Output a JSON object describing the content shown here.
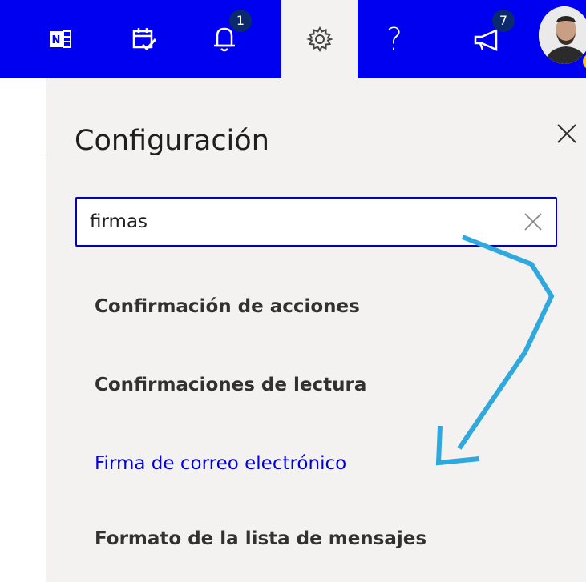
{
  "topbar": {
    "background": "#0000f0",
    "buttons": [
      {
        "name": "onenote-icon"
      },
      {
        "name": "calendar-check-icon"
      },
      {
        "name": "bell-icon",
        "badge": "1"
      },
      {
        "name": "gear-icon",
        "active": true
      },
      {
        "name": "help-icon",
        "label": "?"
      },
      {
        "name": "megaphone-icon",
        "badge": "7"
      }
    ]
  },
  "settings_panel": {
    "title": "Configuración",
    "search": {
      "value": "firmas",
      "placeholder": ""
    },
    "results": [
      {
        "label": "Confirmación de acciones",
        "highlighted": false
      },
      {
        "label": "Confirmaciones de lectura",
        "highlighted": false
      },
      {
        "label": "Firma de correo electrónico",
        "highlighted": true
      },
      {
        "label": "Formato de la lista de mensajes",
        "highlighted": false
      }
    ]
  },
  "colors": {
    "accent": "#0000f0",
    "link": "#0000e0",
    "annotation_arrow": "#2fa8dd",
    "panel_bg": "#f3f2f1"
  }
}
